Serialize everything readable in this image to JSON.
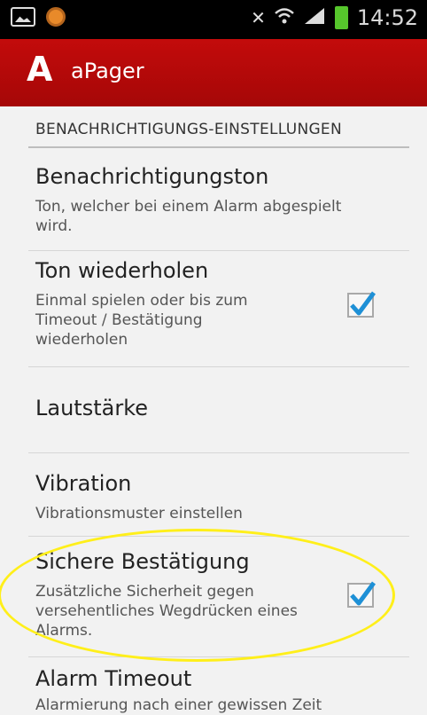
{
  "status_bar": {
    "time": "14:52"
  },
  "app_bar": {
    "logo": "A",
    "title": "aPager"
  },
  "section": {
    "header": "BENACHRICHTIGUNGS-EINSTELLUNGEN"
  },
  "settings": [
    {
      "title": "Benachrichtigungston",
      "summary": "Ton, welcher bei einem Alarm abgespielt wird."
    },
    {
      "title": "Ton wiederholen",
      "summary": "Einmal spielen oder bis zum Timeout / Bestätigung wiederholen",
      "checked": true
    },
    {
      "title": "Lautstärke"
    },
    {
      "title": "Vibration",
      "summary": "Vibrationsmuster einstellen"
    },
    {
      "title": "Sichere Bestätigung",
      "summary": "Zusätzliche Sicherheit gegen versehentliches Wegdrücken eines Alarms.",
      "checked": true
    },
    {
      "title": "Alarm Timeout",
      "summary": "Alarmierung nach einer gewissen Zeit"
    }
  ],
  "colors": {
    "app_bar": "#b80909",
    "accent_check": "#1e90d6",
    "highlight": "#ffef1a"
  }
}
